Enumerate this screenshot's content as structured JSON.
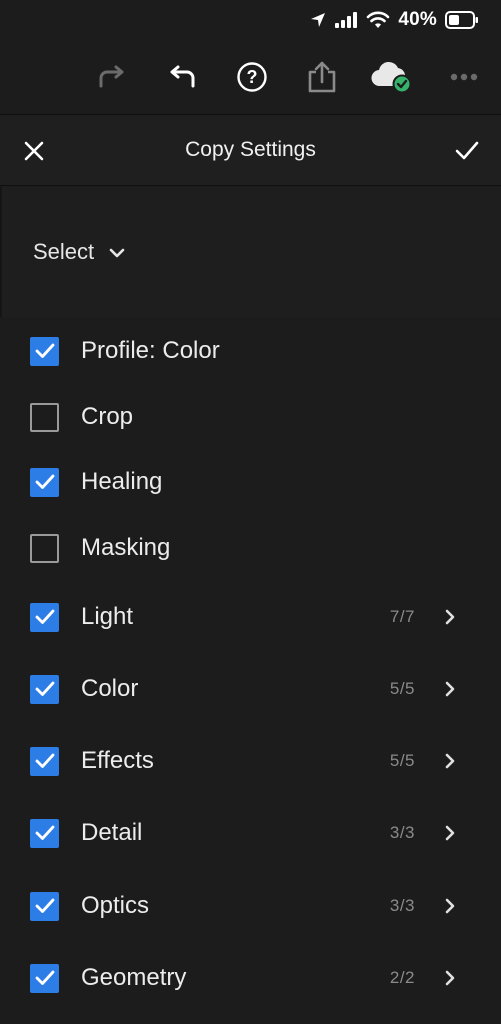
{
  "status_bar": {
    "battery_percent": "40%",
    "icons": [
      "location-arrow-icon",
      "signal-icon",
      "wifi-icon",
      "battery-icon"
    ]
  },
  "toolbar": {
    "icons": [
      "redo-icon",
      "undo-icon",
      "help-icon",
      "share-icon",
      "cloud-synced-icon",
      "more-icon"
    ]
  },
  "header": {
    "title": "Copy Settings",
    "close_icon": "close-icon",
    "confirm_icon": "checkmark-icon"
  },
  "select": {
    "label": "Select"
  },
  "colors": {
    "accent": "#2d7de6",
    "cloud_check": "#35b36b",
    "background": "#1c1c1c"
  },
  "settings": [
    {
      "label": "Profile: Color",
      "checked": true,
      "count": ""
    },
    {
      "label": "Crop",
      "checked": false,
      "count": ""
    },
    {
      "label": "Healing",
      "checked": true,
      "count": ""
    },
    {
      "label": "Masking",
      "checked": false,
      "count": ""
    },
    {
      "label": "Light",
      "checked": true,
      "count": "7/7"
    },
    {
      "label": "Color",
      "checked": true,
      "count": "5/5"
    },
    {
      "label": "Effects",
      "checked": true,
      "count": "5/5"
    },
    {
      "label": "Detail",
      "checked": true,
      "count": "3/3"
    },
    {
      "label": "Optics",
      "checked": true,
      "count": "3/3"
    },
    {
      "label": "Geometry",
      "checked": true,
      "count": "2/2"
    }
  ]
}
